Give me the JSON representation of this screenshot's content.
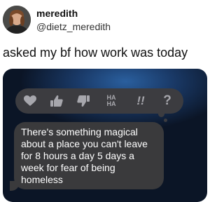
{
  "tweet": {
    "author": {
      "display_name": "meredith",
      "handle": "@dietz_meredith",
      "avatar_icon": "profile-photo"
    },
    "text": "asked my bf how work was today"
  },
  "message": {
    "tapback_icons": [
      "heart-icon",
      "thumbs-up-icon",
      "thumbs-down-icon",
      "haha-icon",
      "exclamation-icon",
      "question-icon"
    ],
    "haha_text": "HA HA",
    "exclaim_text": "!!",
    "question_text": "?",
    "bubble_lines": [
      "There's something magical",
      "about a place you can't leave",
      "for 8 hours a day 5 days a",
      "week for fear of being",
      "homeless"
    ]
  },
  "colors": {
    "tapback_bar": "#3c3c40",
    "icon_gray": "#a7a7ad",
    "bubble": "#3a3a3c",
    "background_dark": "#0b1526",
    "background_blue": "#2a5f9e"
  }
}
